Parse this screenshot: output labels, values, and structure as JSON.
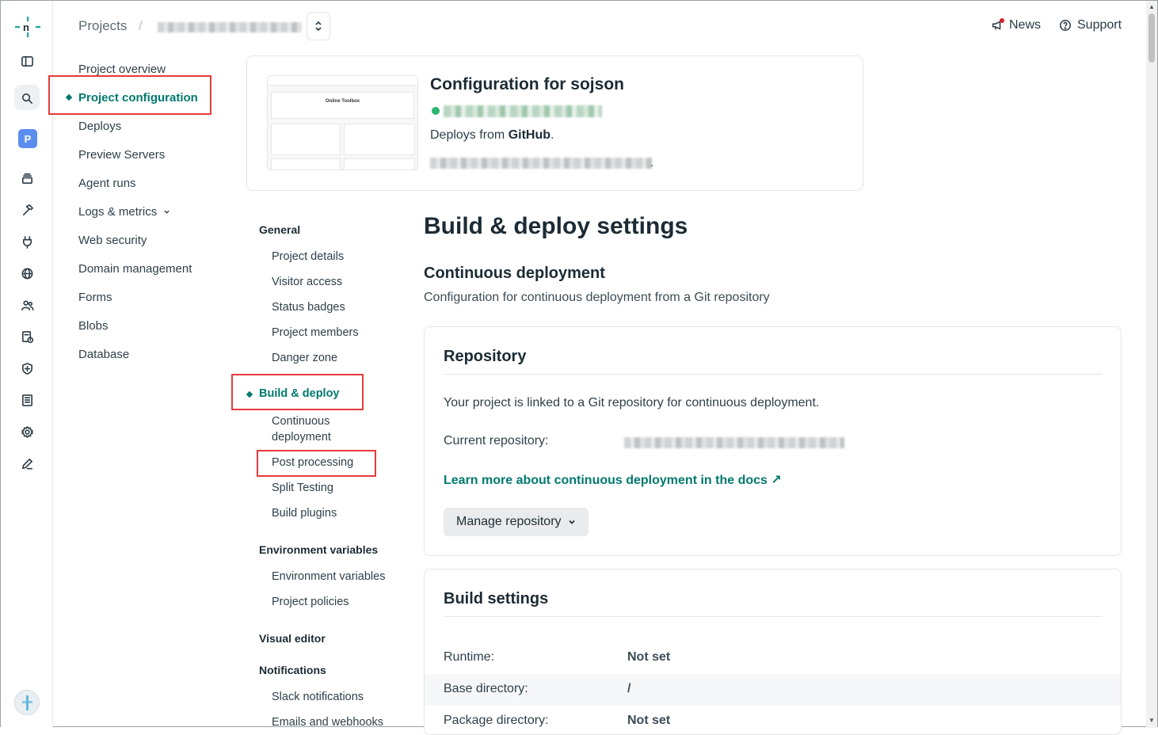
{
  "topbar": {
    "breadcrumb_projects": "Projects",
    "breadcrumb_sep": "/",
    "news_label": "News",
    "support_label": "Support"
  },
  "rail": {
    "project_initial": "P"
  },
  "project_nav": {
    "items": [
      {
        "label": "Project overview"
      },
      {
        "label": "Project configuration",
        "active": true
      },
      {
        "label": "Deploys"
      },
      {
        "label": "Preview Servers"
      },
      {
        "label": "Agent runs"
      },
      {
        "label": "Logs & metrics"
      },
      {
        "label": "Web security"
      },
      {
        "label": "Domain management"
      },
      {
        "label": "Forms"
      },
      {
        "label": "Blobs"
      },
      {
        "label": "Database"
      }
    ]
  },
  "header_card": {
    "title": "Configuration for sojson",
    "deploys_prefix": "Deploys from ",
    "deploys_source": "GitHub",
    "deploys_suffix": ".",
    "url_tail": ".",
    "thumb_title": "Online Toolbox"
  },
  "settings_nav": {
    "general": "General",
    "general_items": [
      "Project details",
      "Visitor access",
      "Status badges",
      "Project members",
      "Danger zone"
    ],
    "build_deploy": "Build & deploy",
    "build_items": [
      "Continuous deployment",
      "Post processing",
      "Split Testing",
      "Build plugins"
    ],
    "env_group": "Environment variables",
    "env_items": [
      "Environment variables",
      "Project policies"
    ],
    "visual_editor": "Visual editor",
    "notifications": "Notifications",
    "notif_items": [
      "Slack notifications",
      "Emails and webhooks"
    ]
  },
  "main": {
    "page_title": "Build & deploy settings",
    "section_title": "Continuous deployment",
    "section_sub": "Configuration for continuous deployment from a Git repository",
    "repository": {
      "title": "Repository",
      "desc": "Your project is linked to a Git repository for continuous deployment.",
      "current_label": "Current repository:",
      "learn_more": "Learn more about continuous deployment in the docs ↗",
      "manage_button": "Manage repository"
    },
    "build_settings": {
      "title": "Build settings",
      "rows": [
        {
          "label": "Runtime:",
          "value": "Not set"
        },
        {
          "label": "Base directory:",
          "value": "/"
        },
        {
          "label": "Package directory:",
          "value": "Not set"
        }
      ]
    }
  },
  "colors": {
    "accent": "#01796f",
    "highlight_box": "#e53b3b",
    "status_green": "#2cb670"
  }
}
